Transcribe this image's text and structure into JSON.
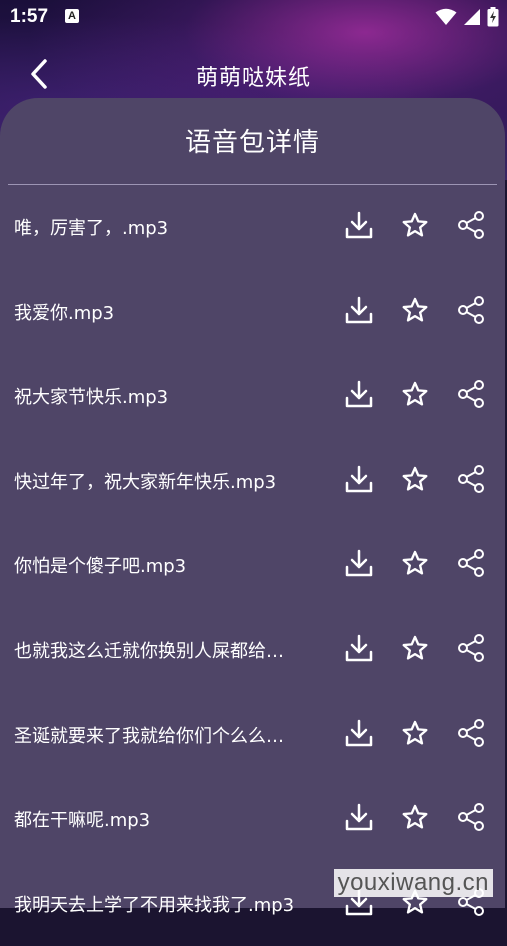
{
  "status_bar": {
    "time": "1:57",
    "notification_icon": "A"
  },
  "app_bar": {
    "title": "萌萌哒妹纸",
    "back_icon": "chevron-left-icon"
  },
  "sheet": {
    "title": "语音包详情"
  },
  "rows": [
    {
      "name": "唯，厉害了，.mp3"
    },
    {
      "name": "我爱你.mp3"
    },
    {
      "name": "祝大家节快乐.mp3"
    },
    {
      "name": "快过年了，祝大家新年快乐.mp3"
    },
    {
      "name": "你怕是个傻子吧.mp3"
    },
    {
      "name": "也就我这么迁就你换别人屎都给…"
    },
    {
      "name": "圣诞就要来了我就给你们个么么…"
    },
    {
      "name": "都在干嘛呢.mp3"
    },
    {
      "name": "我明天去上学了不用来找我了.mp3"
    }
  ],
  "row_icons": [
    "download-icon",
    "star-icon",
    "share-icon"
  ],
  "watermark": "youxiwang.cn",
  "colors": {
    "sheet_bg": "#4f4567",
    "divider": "#9d95b4",
    "text": "#ffffff"
  }
}
